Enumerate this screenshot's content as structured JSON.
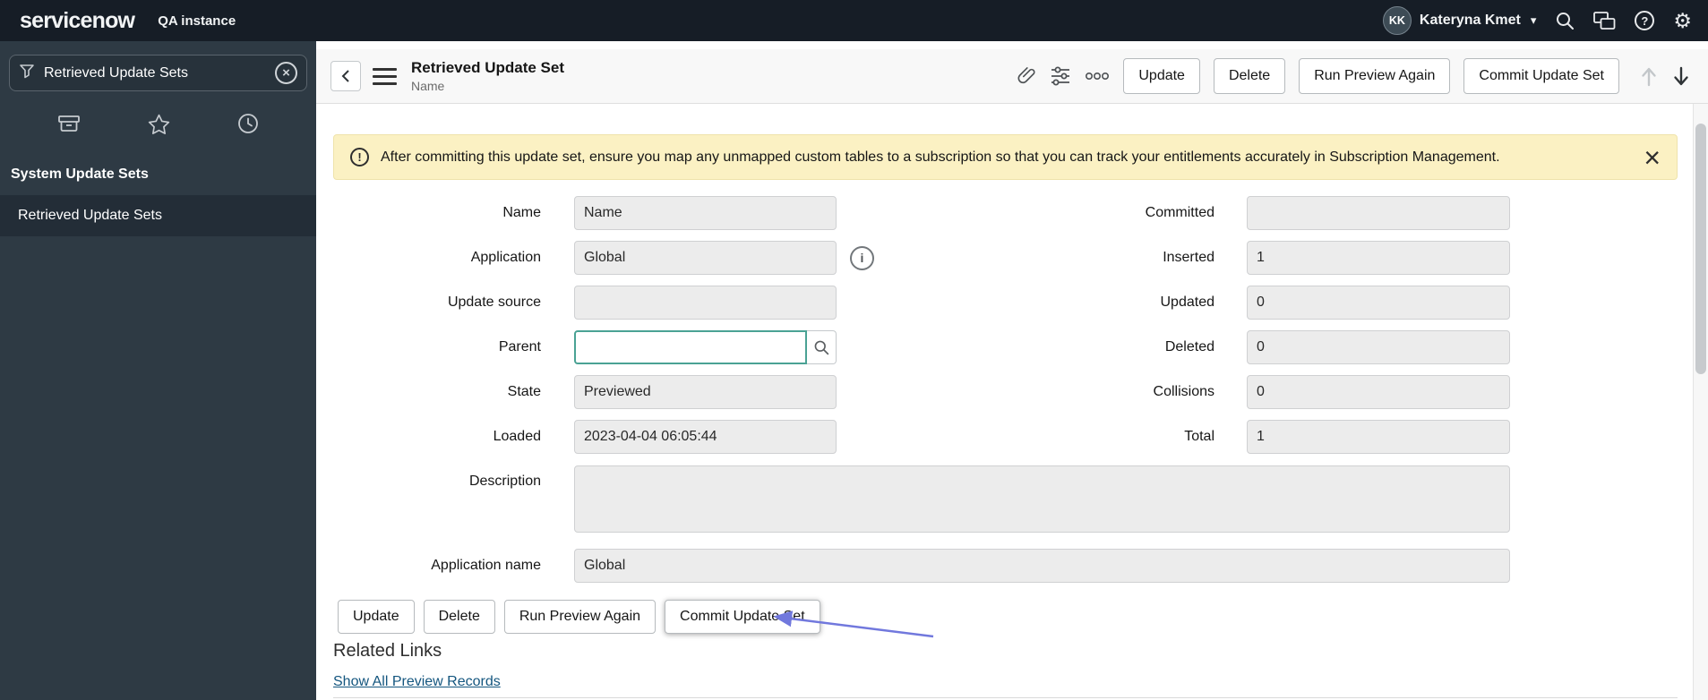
{
  "colors": {
    "header_bg": "#161d26",
    "sidebar_bg": "#2e3a44",
    "sidebar_active_bg": "#232d37",
    "accent_focus": "#4aa294",
    "banner_bg": "#fbf1c3",
    "link": "#14567f",
    "annotation_arrow": "#7178dd"
  },
  "icons": {
    "gear": "⚙",
    "caret": "▾",
    "help": "?",
    "info": "i",
    "warning": "!",
    "banner_close": "×",
    "search_clear": "×"
  },
  "top_header": {
    "logo": "servicenow",
    "instance_label": "QA instance",
    "user": {
      "initials": "KK",
      "name": "Kateryna Kmet"
    }
  },
  "sidebar": {
    "search_value": "Retrieved Update Sets",
    "section_title": "System Update Sets",
    "active_item": "Retrieved Update Sets"
  },
  "form_header": {
    "title": "Retrieved Update Set",
    "subtitle": "Name",
    "actions": {
      "update": "Update",
      "delete": "Delete",
      "run_preview": "Run Preview Again",
      "commit": "Commit Update Set"
    }
  },
  "banner": {
    "text": "After committing this update set, ensure you map any unmapped custom tables to a subscription so that you can track your entitlements accurately in Subscription Management."
  },
  "fields": {
    "left": [
      {
        "label": "Name",
        "value": "Name"
      },
      {
        "label": "Application",
        "value": "Global"
      },
      {
        "label": "Update source",
        "value": ""
      },
      {
        "label": "Parent",
        "value": ""
      },
      {
        "label": "State",
        "value": "Previewed"
      },
      {
        "label": "Loaded",
        "value": "2023-04-04 06:05:44"
      }
    ],
    "right": [
      {
        "label": "Committed",
        "value": ""
      },
      {
        "label": "Inserted",
        "value": "1"
      },
      {
        "label": "Updated",
        "value": "0"
      },
      {
        "label": "Deleted",
        "value": "0"
      },
      {
        "label": "Collisions",
        "value": "0"
      },
      {
        "label": "Total",
        "value": "1"
      }
    ],
    "description": {
      "label": "Description",
      "value": ""
    },
    "application_name": {
      "label": "Application name",
      "value": "Global"
    }
  },
  "footer_actions": {
    "update": "Update",
    "delete": "Delete",
    "run_preview": "Run Preview Again",
    "commit": "Commit Update Set"
  },
  "related_links": {
    "title": "Related Links",
    "link": "Show All Preview Records"
  }
}
